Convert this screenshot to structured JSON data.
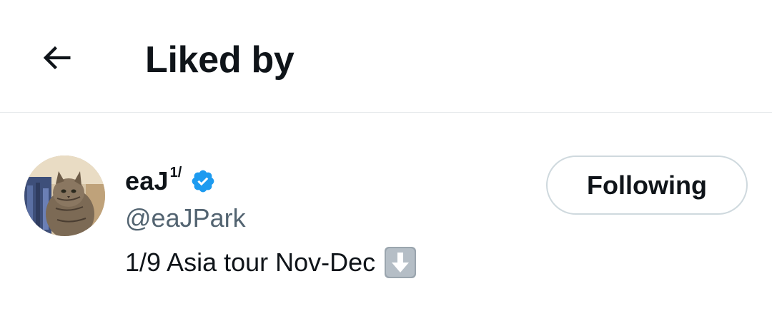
{
  "header": {
    "title": "Liked by",
    "back_icon": "arrow-left-icon"
  },
  "user": {
    "display_name": "eaJ",
    "display_name_superscript": "1/",
    "verified": true,
    "verified_icon": "verified-badge-icon",
    "handle": "@eaJPark",
    "bio": "1/9 Asia tour Nov-Dec",
    "bio_emoji": "down-arrow-emoji-icon",
    "follow_button_label": "Following",
    "avatar_icon": "cat-avatar"
  },
  "colors": {
    "text_primary": "#0f1419",
    "text_secondary": "#536471",
    "verified_blue": "#1d9bf0",
    "border": "#cfd9de",
    "divider": "#e6e9eb"
  }
}
